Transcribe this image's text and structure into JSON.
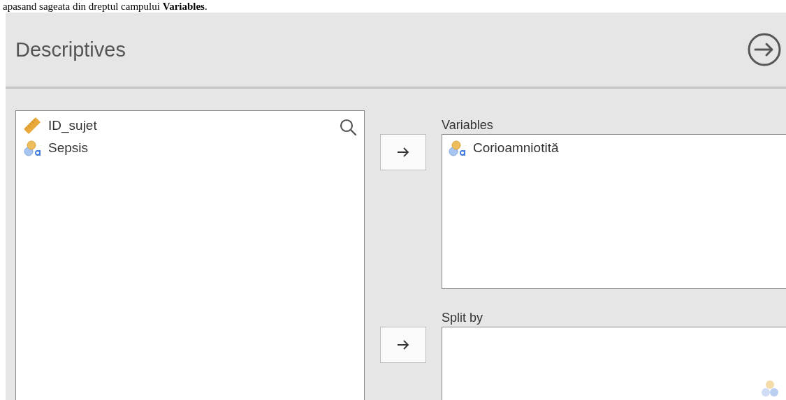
{
  "caption": "apasand sageata din dreptul campului **Variables**.",
  "panel": {
    "title": "Descriptives"
  },
  "source_list": {
    "items": [
      {
        "name": "ID_sujet",
        "kind": "continuous"
      },
      {
        "name": "Sepsis",
        "kind": "nominal"
      }
    ]
  },
  "targets": [
    {
      "label": "Variables",
      "items": [
        {
          "name": "Corioamniotită",
          "kind": "nominal"
        }
      ]
    },
    {
      "label": "Split by"
    }
  ]
}
